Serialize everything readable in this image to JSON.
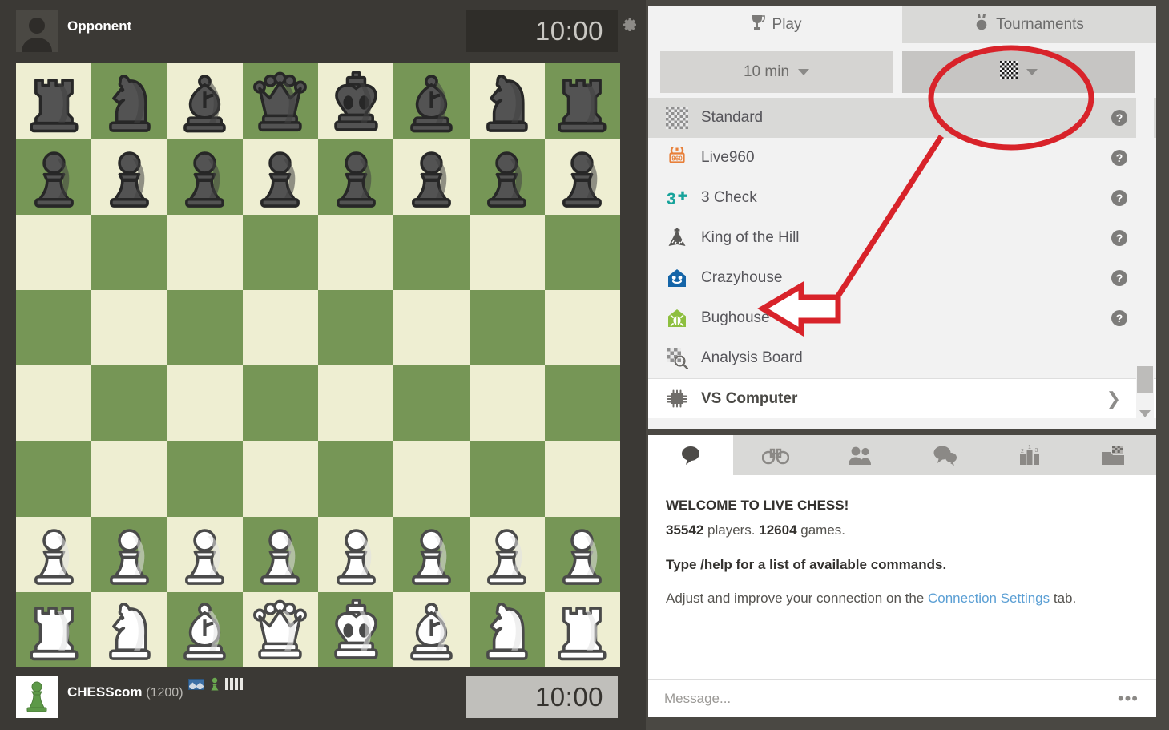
{
  "board_panel": {
    "opponent": {
      "name": "Opponent",
      "clock": "10:00",
      "avatar_icon": "person-silhouette-icon",
      "gear_icon": "gear-icon"
    },
    "self": {
      "name": "CHESScom",
      "rating": "(1200)",
      "clock": "10:00",
      "avatar_icon": "green-pawn-icon",
      "badges": [
        "flag-badge-icon",
        "pawn-badge-icon",
        "bars-badge-icon"
      ]
    },
    "colors": {
      "light_square": "#eeeed2",
      "dark_square": "#769656",
      "background": "#3b3935"
    },
    "position": [
      [
        "br",
        "bn",
        "bb",
        "bq",
        "bk",
        "bb",
        "bn",
        "br"
      ],
      [
        "bp",
        "bp",
        "bp",
        "bp",
        "bp",
        "bp",
        "bp",
        "bp"
      ],
      [
        "",
        "",
        "",
        "",
        "",
        "",
        "",
        ""
      ],
      [
        "",
        "",
        "",
        "",
        "",
        "",
        "",
        ""
      ],
      [
        "",
        "",
        "",
        "",
        "",
        "",
        "",
        ""
      ],
      [
        "",
        "",
        "",
        "",
        "",
        "",
        "",
        ""
      ],
      [
        "wp",
        "wp",
        "wp",
        "wp",
        "wp",
        "wp",
        "wp",
        "wp"
      ],
      [
        "wr",
        "wn",
        "wb",
        "wq",
        "wk",
        "wb",
        "wn",
        "wr"
      ]
    ]
  },
  "side": {
    "top_tabs": [
      {
        "label": "Play",
        "icon": "trophy-icon",
        "active": true
      },
      {
        "label": "Tournaments",
        "icon": "medal-icon",
        "active": false
      }
    ],
    "controls": {
      "time_label": "10 min",
      "time_icon": "chevron-down-icon",
      "variant_icon": "checkerboard-icon",
      "variant_caret": "chevron-down-icon"
    },
    "variants": [
      {
        "label": "Standard",
        "icon": "checkerboard-icon",
        "selected": true,
        "help": "?",
        "bold": false
      },
      {
        "label": "Live960",
        "icon": "live960-icon",
        "selected": false,
        "help": "?",
        "bold": false
      },
      {
        "label": "3 Check",
        "icon": "three-check-icon",
        "selected": false,
        "help": "?",
        "bold": false
      },
      {
        "label": "King of the Hill",
        "icon": "hill-icon",
        "selected": false,
        "help": "?",
        "bold": false
      },
      {
        "label": "Crazyhouse",
        "icon": "crazyhouse-icon",
        "selected": false,
        "help": "?",
        "bold": false
      },
      {
        "label": "Bughouse",
        "icon": "bughouse-icon",
        "selected": false,
        "help": "?",
        "bold": false
      },
      {
        "label": "Analysis Board",
        "icon": "analysis-board-icon",
        "selected": false,
        "help": "",
        "bold": false
      },
      {
        "label": "VS Computer",
        "icon": "cpu-icon",
        "selected": false,
        "help": "",
        "bold": true,
        "chevron": "chevron-right-icon"
      }
    ],
    "chat_tabs": [
      {
        "icon": "chat-bubble-icon",
        "active": true
      },
      {
        "icon": "binoculars-icon",
        "active": false
      },
      {
        "icon": "friends-icon",
        "active": false
      },
      {
        "icon": "chat-bubbles-icon",
        "active": false
      },
      {
        "icon": "leaderboard-icon",
        "active": false
      },
      {
        "icon": "archive-games-icon",
        "active": false
      }
    ],
    "chat": {
      "welcome": "WELCOME TO LIVE CHESS!",
      "players_count": "35542",
      "players_word": " players. ",
      "games_count": "12604",
      "games_word": " games.",
      "help_line": "Type /help for a list of available commands.",
      "conn_prefix": "Adjust and improve your connection on the ",
      "conn_link": "Connection Settings",
      "conn_suffix": " tab."
    },
    "message_bar": {
      "placeholder": "Message...",
      "more_icon": "ellipsis-icon",
      "more_label": "•••"
    }
  },
  "annotation": {
    "color": "#d8232a",
    "shapes": [
      "highlight-ellipse",
      "pointer-arrow",
      "connector-line"
    ]
  }
}
